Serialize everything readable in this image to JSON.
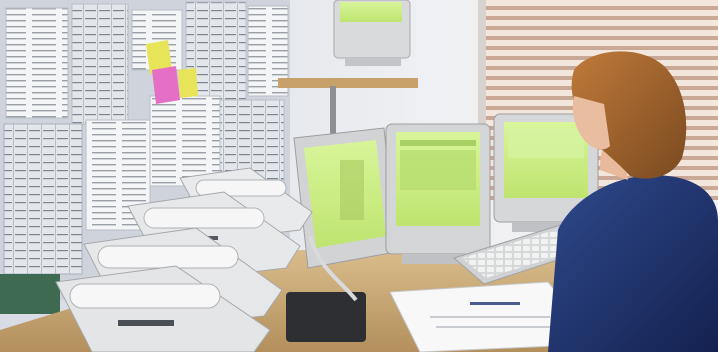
{
  "scene": {
    "description_colors": {
      "screen_green": "#c9ee7f",
      "wall": "#e9eaee",
      "desk_wood": "#c9a877",
      "sweater_blue": "#23356e",
      "hair_brown": "#a3662e",
      "blinds": "#efdfd3"
    },
    "objects": [
      "wall-with-papers-icon",
      "sticky-note-icon",
      "crt-monitor-icon",
      "desk-phone-icon",
      "keyboard-icon",
      "window-blinds-icon",
      "document-icon",
      "person-icon"
    ]
  }
}
